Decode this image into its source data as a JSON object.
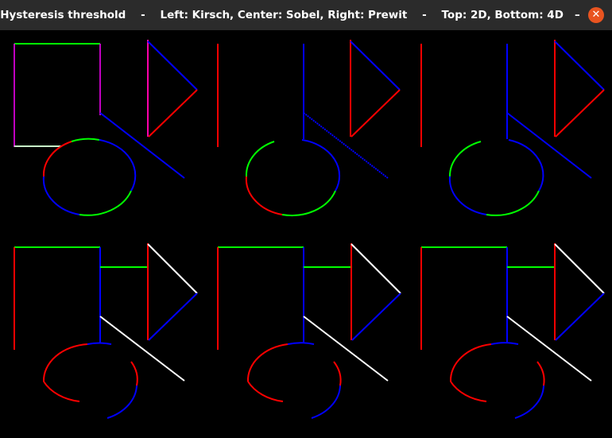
{
  "window": {
    "title": "Hysteresis threshold    -    Left: Kirsch, Center: Sobel, Right: Prewit    -    Top: 2D, Bottom: 4D   –",
    "close_icon": "close-icon",
    "accent_close": "#e95420"
  },
  "colors": {
    "red": "#ff0000",
    "green": "#00ff00",
    "blue": "#0000ff",
    "white": "#ffffff",
    "magenta": "#c000c0",
    "background": "#000000"
  },
  "panels": [
    {
      "name": "panel-kirsch-2d",
      "row": "top",
      "col": "left"
    },
    {
      "name": "panel-sobel-2d",
      "row": "top",
      "col": "center"
    },
    {
      "name": "panel-prewit-2d",
      "row": "top",
      "col": "right"
    },
    {
      "name": "panel-kirsch-4d",
      "row": "bottom",
      "col": "left"
    },
    {
      "name": "panel-sobel-4d",
      "row": "bottom",
      "col": "center"
    },
    {
      "name": "panel-prewit-4d",
      "row": "bottom",
      "col": "right"
    }
  ]
}
